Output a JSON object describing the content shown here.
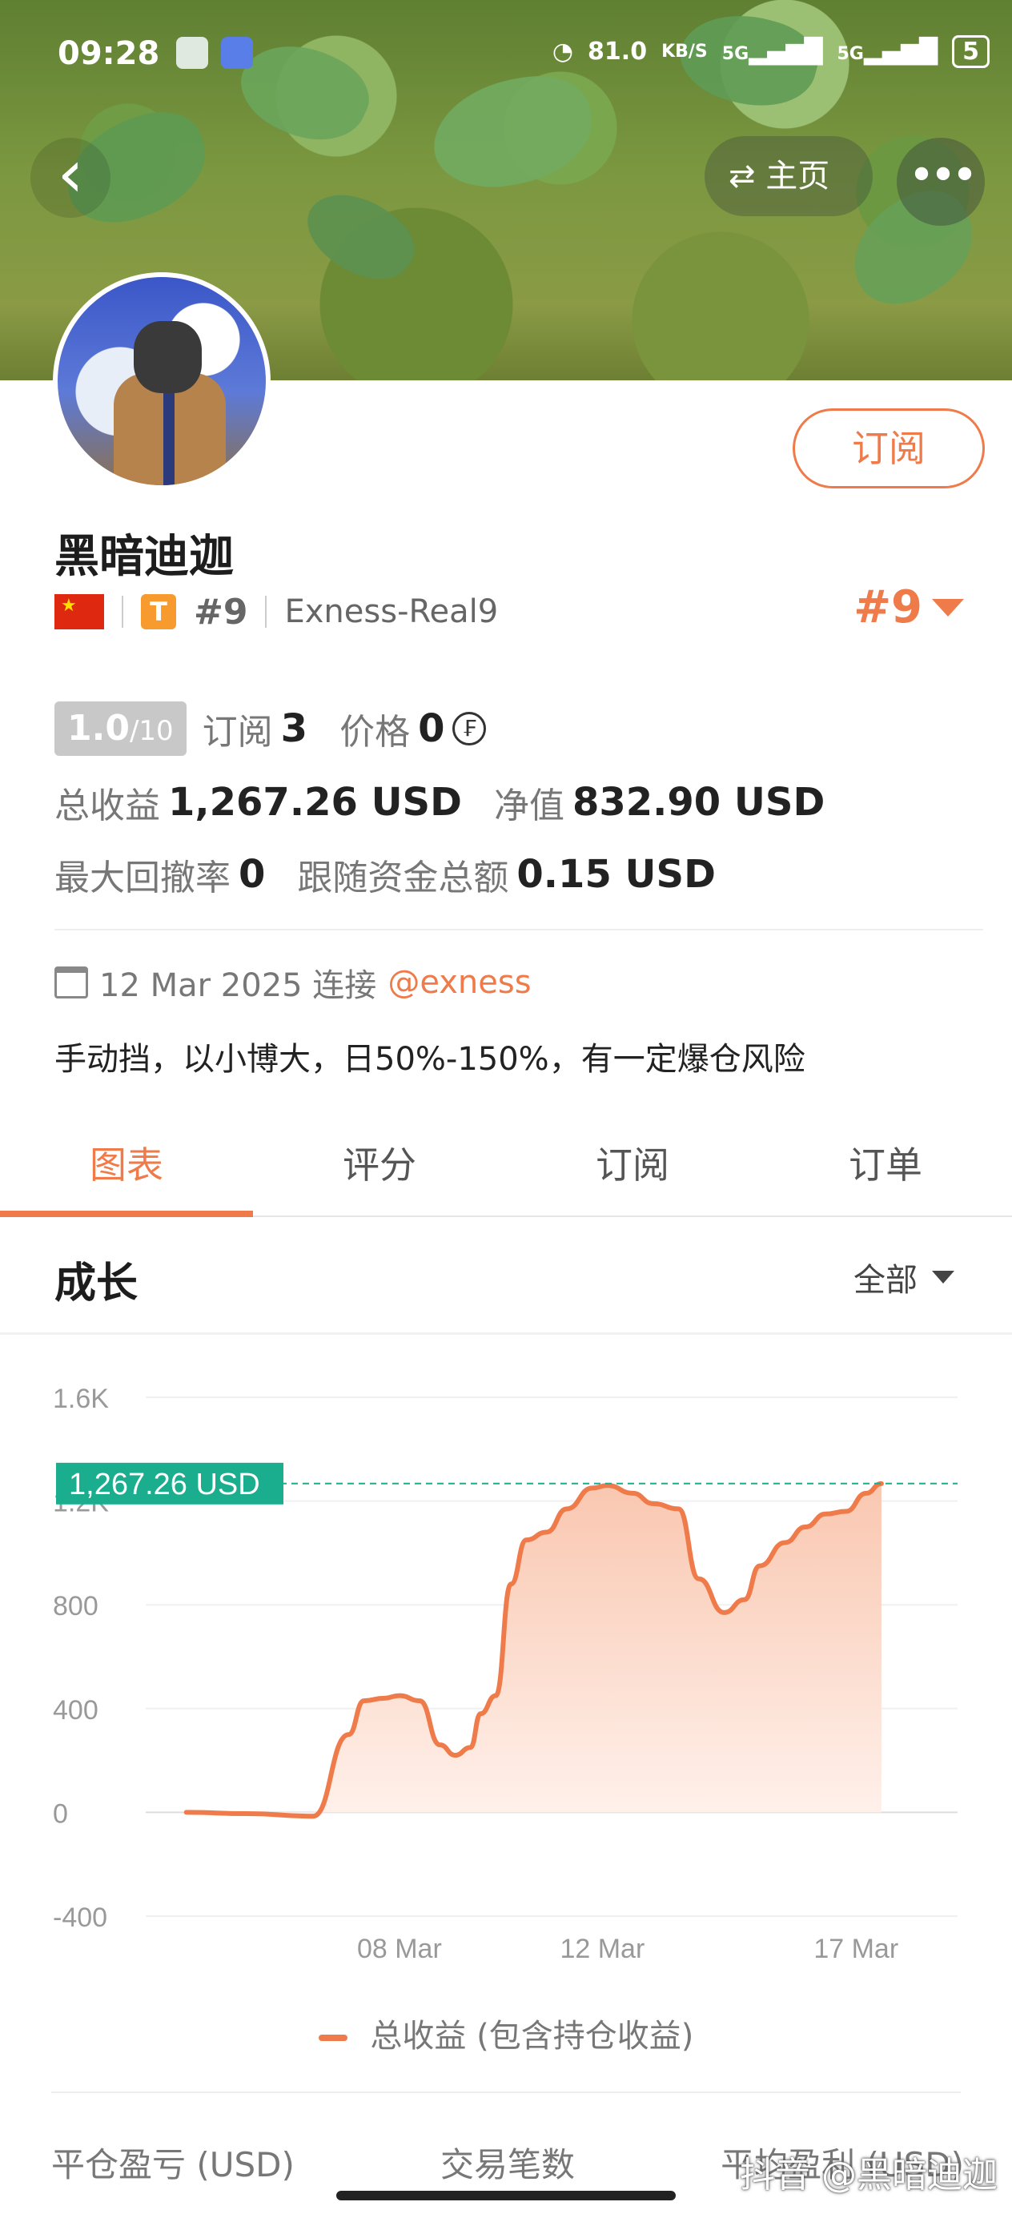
{
  "status_bar": {
    "time": "09:28",
    "speed": "81.0",
    "speed_unit": "KB/S",
    "signal_1": "5G",
    "signal_2": "5G",
    "battery": "5"
  },
  "header": {
    "home_label": "主页",
    "back_icon": "chevron-left-icon",
    "more_icon": "more-horizontal-icon"
  },
  "profile": {
    "name": "黑暗迪迦",
    "subscribe_label": "订阅",
    "country_flag": "china-flag",
    "tier_badge": "T",
    "rank_small": "#9",
    "account": "Exness-Real9",
    "rank_large": "#9"
  },
  "stats": {
    "score": "1.0",
    "score_max": "/10",
    "subscribe_label": "订阅",
    "subscribe_count": "3",
    "price_label": "价格",
    "price_value": "0",
    "price_currency_icon": "₣",
    "total_profit_label": "总收益",
    "total_profit_value": "1,267.26 USD",
    "net_value_label": "净值",
    "net_value": "832.90 USD",
    "max_drawdown_label": "最大回撤率",
    "max_drawdown_value": "0",
    "follow_funds_label": "跟随资金总额",
    "follow_funds_value": "0.15 USD"
  },
  "connection": {
    "date": "12 Mar 2025 连接",
    "broker": "@exness"
  },
  "description": "手动挡，以小博大，日50%-150%，有一定爆仓风险",
  "tabs": [
    {
      "label": "图表",
      "active": true
    },
    {
      "label": "评分",
      "active": false
    },
    {
      "label": "订阅",
      "active": false
    },
    {
      "label": "订单",
      "active": false
    }
  ],
  "growth": {
    "title": "成长",
    "range": "全部",
    "legend": "总收益 (包含持仓收益)",
    "current_label": "1,267.26 USD"
  },
  "bottom_headers": [
    "平仓盈亏 (USD)",
    "交易笔数",
    "平均盈利 (USD)"
  ],
  "watermark": "抖音 @黑暗迪迦",
  "colors": {
    "accent": "#ef7b4a",
    "marker": "#1aae8e",
    "fill_top": "#f9c7b0",
    "fill_bottom": "#fff1eb"
  },
  "chart_data": {
    "type": "area",
    "title": "成长",
    "ylim": [
      -400,
      1600
    ],
    "yticks": [
      -400,
      0,
      400,
      800,
      1200,
      1600
    ],
    "ytick_labels": [
      "-400",
      "0",
      "400",
      "800",
      "1.2K",
      "1.6K"
    ],
    "xlim": [
      3,
      19
    ],
    "xticks": [
      8,
      12,
      17
    ],
    "xtick_labels": [
      "08 Mar",
      "12 Mar",
      "17 Mar"
    ],
    "grid": true,
    "reference_line": 1267.26,
    "series": [
      {
        "name": "总收益 (包含持仓收益)",
        "x": [
          3.8,
          5.0,
          6.3,
          7.0,
          7.3,
          7.7,
          8.0,
          8.4,
          8.8,
          9.1,
          9.4,
          9.6,
          9.9,
          10.2,
          10.5,
          10.9,
          11.3,
          11.8,
          12.1,
          12.6,
          13.0,
          13.5,
          13.9,
          14.4,
          14.8,
          15.1,
          15.6,
          16.0,
          16.4,
          16.8,
          17.2,
          17.5
        ],
        "y": [
          0,
          -5,
          -15,
          300,
          430,
          440,
          450,
          430,
          260,
          220,
          250,
          380,
          450,
          880,
          1050,
          1080,
          1170,
          1250,
          1260,
          1230,
          1190,
          1170,
          900,
          770,
          820,
          950,
          1040,
          1100,
          1150,
          1160,
          1230,
          1267
        ]
      }
    ]
  }
}
